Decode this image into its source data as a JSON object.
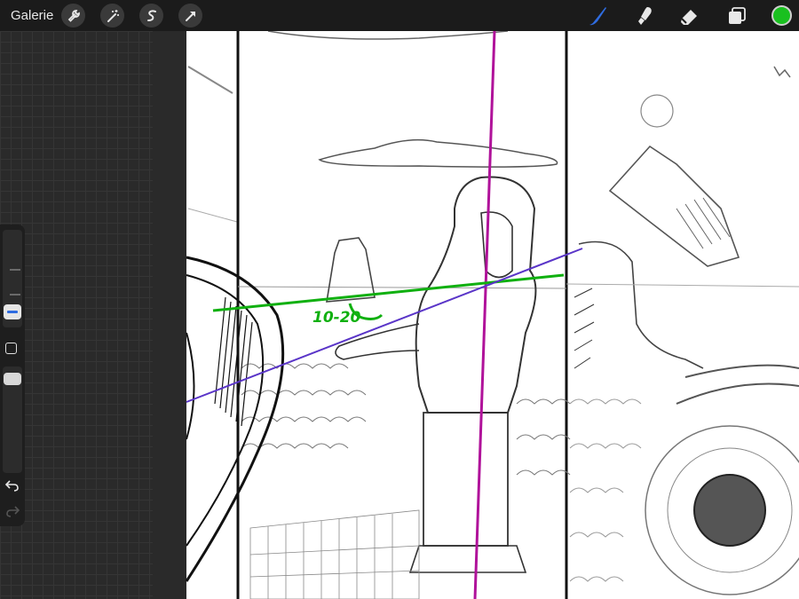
{
  "topbar": {
    "gallery_label": "Galerie",
    "tools_left": [
      "wrench-icon",
      "magic-wand-icon",
      "selection-s-icon",
      "transform-arrow-icon"
    ],
    "tools_right": [
      "brush-icon",
      "smudge-icon",
      "eraser-icon",
      "layers-icon"
    ],
    "active_tool": "brush-icon",
    "current_color": "#19c01f",
    "accent_color": "#2f6ce0"
  },
  "sidebar": {
    "brush_size_level": 0.55,
    "opacity_level": 1.0,
    "undo_icon": "undo-icon",
    "redo_icon": "redo-icon",
    "modify_button_icon": "square-icon"
  },
  "canvas": {
    "annotation_text": "10-20",
    "guide_colors": {
      "green": "#10b010",
      "purple": "#5a35c8",
      "magenta": "#b0129a"
    }
  }
}
